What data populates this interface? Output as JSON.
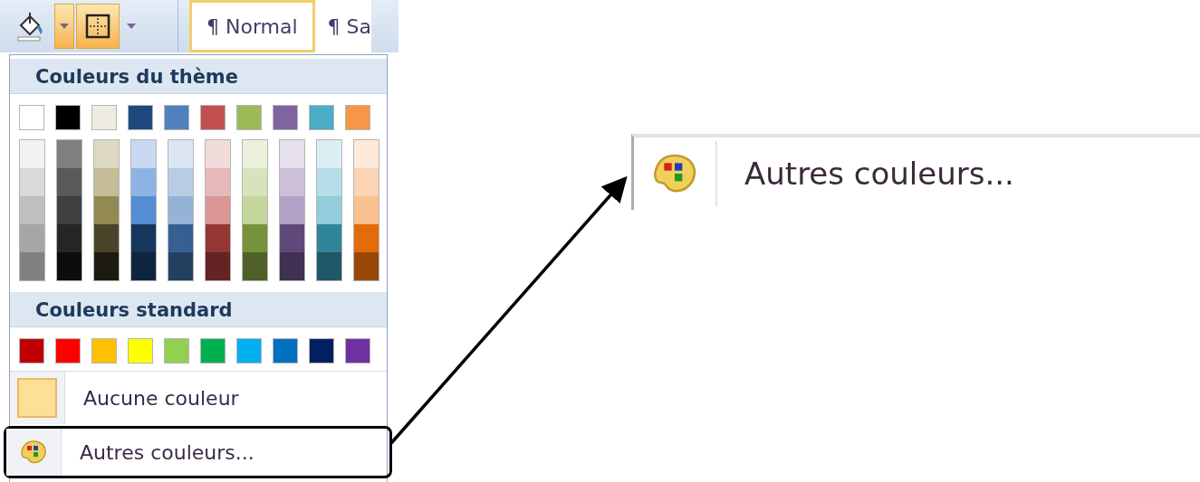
{
  "toolbar": {
    "tools": [
      {
        "kind": "fill-color",
        "highlighted": false
      },
      {
        "kind": "dropdown",
        "highlighted": true
      },
      {
        "kind": "borders",
        "highlighted": true
      },
      {
        "kind": "dropdown",
        "highlighted": false
      }
    ],
    "styles": [
      {
        "label": "¶ Normal",
        "selected": true
      },
      {
        "label": "¶ Sa",
        "selected": false
      }
    ]
  },
  "menu": {
    "theme_header": "Couleurs du thème",
    "theme_colors": [
      {
        "color": "#ffffff",
        "shades": [
          {
            "color": "#f2f2f2"
          },
          {
            "color": "#d9d9d9"
          },
          {
            "color": "#bfbfbf"
          },
          {
            "color": "#a6a6a6"
          },
          {
            "color": "#808080"
          }
        ]
      },
      {
        "color": "#000000",
        "shades": [
          {
            "color": "#7f7f7f"
          },
          {
            "color": "#595959"
          },
          {
            "color": "#3f3f3f"
          },
          {
            "color": "#262626"
          },
          {
            "color": "#0d0d0d"
          }
        ]
      },
      {
        "color": "#eeece1",
        "shades": [
          {
            "color": "#ddd9c3"
          },
          {
            "color": "#c4bd97"
          },
          {
            "color": "#938953"
          },
          {
            "color": "#494429"
          },
          {
            "color": "#1d1b10"
          }
        ]
      },
      {
        "color": "#1f497d",
        "shades": [
          {
            "color": "#c6d9f0"
          },
          {
            "color": "#8db3e2"
          },
          {
            "color": "#548dd4"
          },
          {
            "color": "#17365d"
          },
          {
            "color": "#0f243e"
          }
        ]
      },
      {
        "color": "#4f81bd",
        "shades": [
          {
            "color": "#dbe5f1"
          },
          {
            "color": "#b8cce4"
          },
          {
            "color": "#95b3d7"
          },
          {
            "color": "#366092"
          },
          {
            "color": "#244061"
          }
        ]
      },
      {
        "color": "#c0504d",
        "shades": [
          {
            "color": "#f2dcdb"
          },
          {
            "color": "#e5b9b7"
          },
          {
            "color": "#d99694"
          },
          {
            "color": "#953734"
          },
          {
            "color": "#632423"
          }
        ]
      },
      {
        "color": "#9bbb59",
        "shades": [
          {
            "color": "#ebf1dd"
          },
          {
            "color": "#d7e3bc"
          },
          {
            "color": "#c3d69b"
          },
          {
            "color": "#76923c"
          },
          {
            "color": "#4f6128"
          }
        ]
      },
      {
        "color": "#8064a2",
        "shades": [
          {
            "color": "#e5e0ec"
          },
          {
            "color": "#ccc1d9"
          },
          {
            "color": "#b2a2c7"
          },
          {
            "color": "#5f497a"
          },
          {
            "color": "#3f3151"
          }
        ]
      },
      {
        "color": "#4bacc6",
        "shades": [
          {
            "color": "#dbeef3"
          },
          {
            "color": "#b7dde8"
          },
          {
            "color": "#92cddc"
          },
          {
            "color": "#31859b"
          },
          {
            "color": "#205867"
          }
        ]
      },
      {
        "color": "#f79646",
        "shades": [
          {
            "color": "#fdeada"
          },
          {
            "color": "#fbd5b5"
          },
          {
            "color": "#fac08f"
          },
          {
            "color": "#e36c09"
          },
          {
            "color": "#974806"
          }
        ]
      }
    ],
    "standard_header": "Couleurs standard",
    "standard_colors": [
      {
        "color": "#c00000"
      },
      {
        "color": "#ff0000"
      },
      {
        "color": "#ffc000"
      },
      {
        "color": "#ffff00"
      },
      {
        "color": "#92d050"
      },
      {
        "color": "#00b050"
      },
      {
        "color": "#00b0f0"
      },
      {
        "color": "#0070c0"
      },
      {
        "color": "#002060"
      },
      {
        "color": "#7030a0"
      }
    ],
    "items": [
      {
        "label": "Aucune couleur",
        "kind": "no-color",
        "highlighted": false
      },
      {
        "label": "Autres couleurs...",
        "kind": "more-colors",
        "highlighted": true
      }
    ]
  },
  "callout": {
    "label": "Autres couleurs..."
  }
}
